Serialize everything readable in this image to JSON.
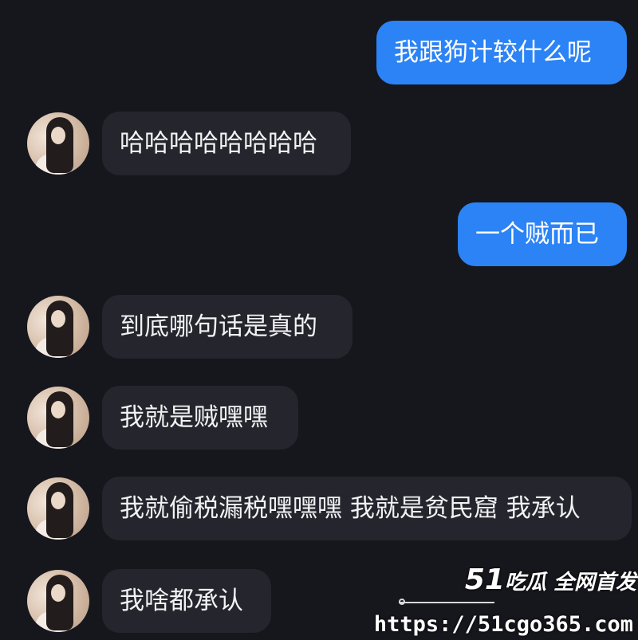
{
  "messages": [
    {
      "side": "mine",
      "text": "我跟狗计较什么呢"
    },
    {
      "side": "theirs",
      "text": "哈哈哈哈哈哈哈哈"
    },
    {
      "side": "mine",
      "text": "一个贼而已"
    },
    {
      "side": "theirs",
      "text": "到底哪句话是真的"
    },
    {
      "side": "theirs",
      "text": "我就是贼嘿嘿"
    },
    {
      "side": "theirs",
      "text": "我就偷税漏税嘿嘿嘿 我就是贫民窟 我承认"
    },
    {
      "side": "theirs",
      "text": "我啥都承认"
    }
  ],
  "watermark": {
    "brand_number": "51",
    "brand_text": "吃瓜 全网首发",
    "url": "https://51cgo365.com"
  },
  "colors": {
    "background": "#16161d",
    "my_bubble": "#2b83f6",
    "their_bubble": "#25252d"
  },
  "icons": {
    "avatar": "contact-avatar-photo"
  }
}
